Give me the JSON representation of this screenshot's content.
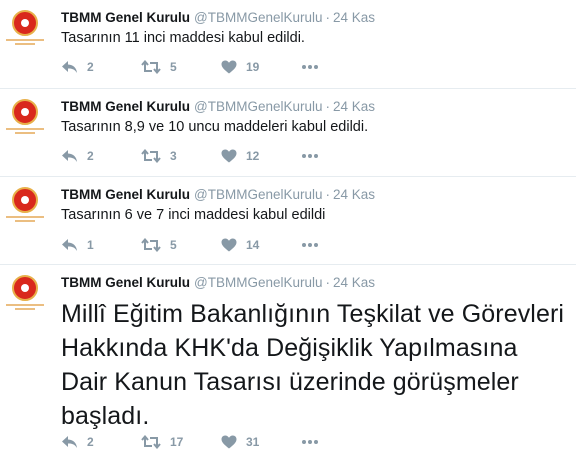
{
  "colors": {
    "muted": "#8899a6",
    "text": "#14171a",
    "divider": "#e6ecf0",
    "seal": "#d9281c"
  },
  "tweets": [
    {
      "name": "TBMM Genel Kurulu",
      "handle": "@TBMMGenelKurulu",
      "sep": "·",
      "time": "24 Kas",
      "text": "Tasarının 11 inci maddesi kabul edildi.",
      "replies": "2",
      "retweets": "5",
      "likes": "19"
    },
    {
      "name": "TBMM Genel Kurulu",
      "handle": "@TBMMGenelKurulu",
      "sep": "·",
      "time": "24 Kas",
      "text": "Tasarının 8,9 ve 10 uncu maddeleri kabul edildi.",
      "replies": "2",
      "retweets": "3",
      "likes": "12"
    },
    {
      "name": "TBMM Genel Kurulu",
      "handle": "@TBMMGenelKurulu",
      "sep": "·",
      "time": "24 Kas",
      "text": "Tasarının 6 ve 7 inci maddesi kabul edildi",
      "replies": "1",
      "retweets": "5",
      "likes": "14"
    },
    {
      "name": "TBMM Genel Kurulu",
      "handle": "@TBMMGenelKurulu",
      "sep": "·",
      "time": "24 Kas",
      "text": "Millî Eğitim Bakanlığının Teşkilat ve Görevleri Hakkında KHK'da Değişiklik Yapılmasına Dair Kanun Tasarısı üzerinde görüşmeler başladı.",
      "replies": "2",
      "retweets": "17",
      "likes": "31"
    }
  ],
  "icons": {
    "reply": "reply-icon",
    "retweet": "retweet-icon",
    "like": "heart-icon",
    "more": "more-icon"
  }
}
